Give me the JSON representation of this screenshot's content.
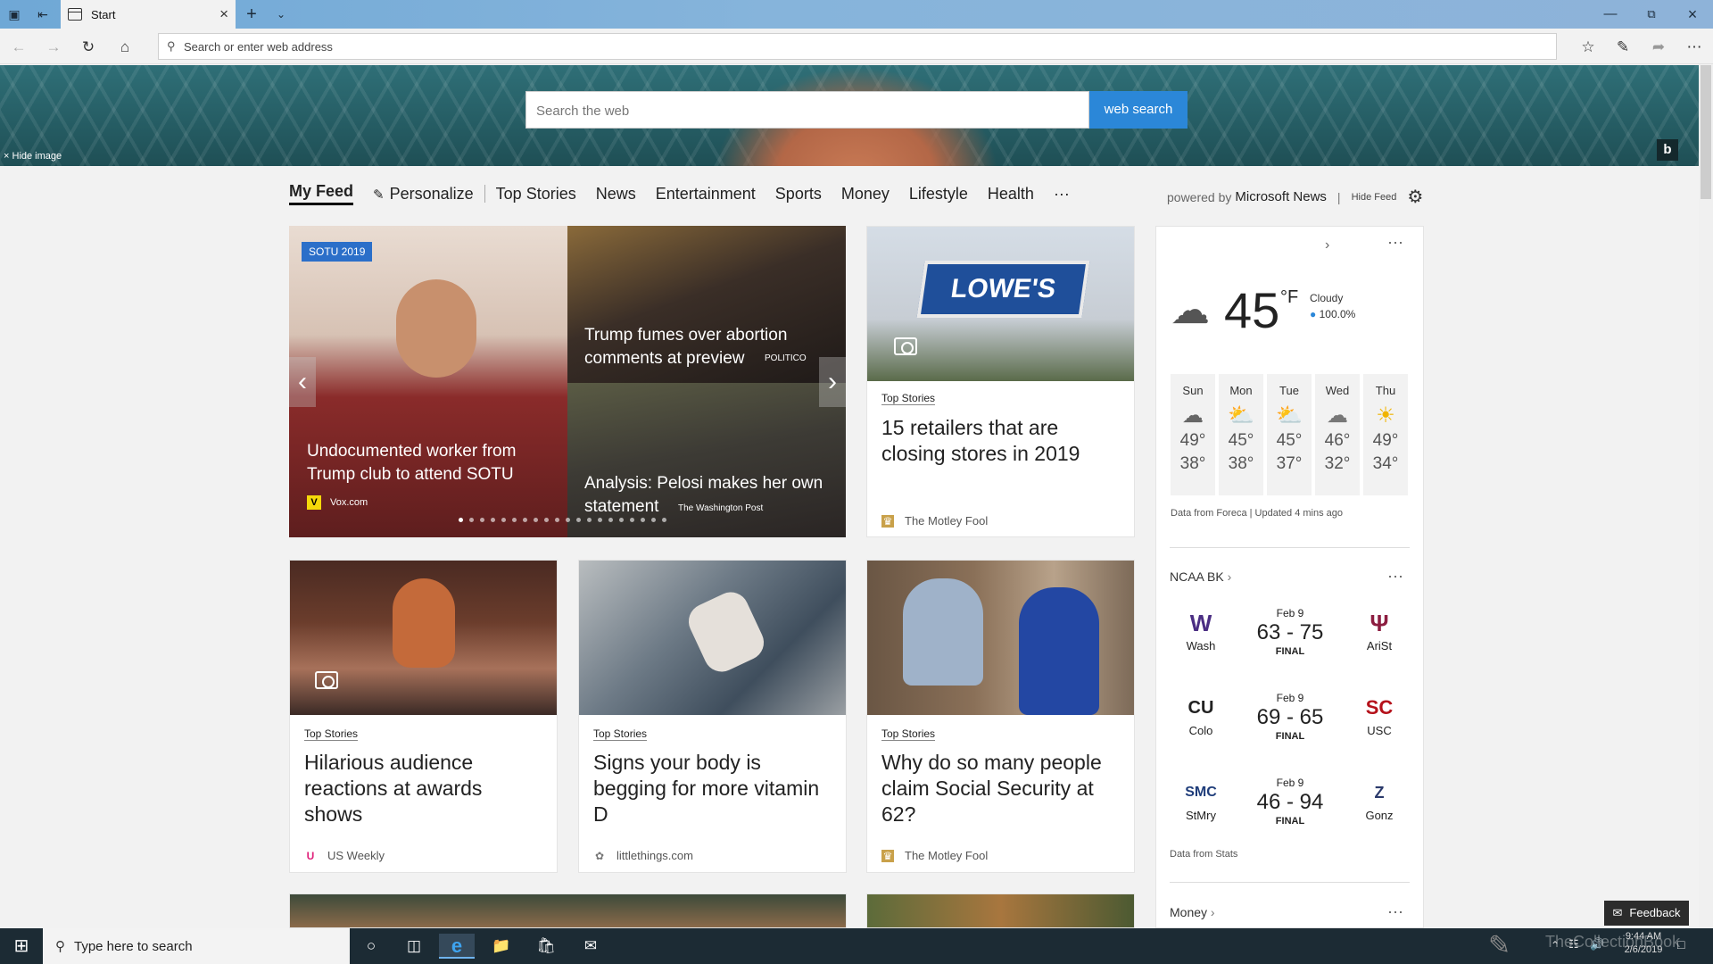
{
  "browser": {
    "tab_title": "Start",
    "address_placeholder": "Search or enter web address"
  },
  "hero": {
    "search_placeholder": "Search the web",
    "search_button": "web search",
    "hide_image": "Hide image",
    "bing_logo": "b"
  },
  "feed_nav": {
    "items": [
      "My Feed",
      "Personalize",
      "Top Stories",
      "News",
      "Entertainment",
      "Sports",
      "Money",
      "Lifestyle",
      "Health",
      "···"
    ],
    "powered_by": "powered by",
    "provider": "Microsoft News",
    "hide_feed": "Hide Feed"
  },
  "carousel": {
    "badge": "SOTU 2019",
    "main_title": "Undocumented worker from Trump club to attend SOTU",
    "main_source": "Vox.com",
    "top_right_title": "Trump fumes over abortion comments at preview",
    "top_right_source": "POLITICO",
    "bottom_right_title": "Analysis: Pelosi makes her own statement",
    "bottom_right_source": "The Washington Post",
    "dot_count": 20,
    "active_dot": 0
  },
  "cards": [
    {
      "category": "Top Stories",
      "title": "15 retailers that are closing stores in 2019",
      "source": "The Motley Fool",
      "image_text": "LOWE'S"
    },
    {
      "category": "Top Stories",
      "title": "Hilarious audience reactions at awards shows",
      "source": "US Weekly"
    },
    {
      "category": "Top Stories",
      "title": "Signs your body is begging for more vitamin D",
      "source": "littlethings.com"
    },
    {
      "category": "Top Stories",
      "title": "Why do so many people claim Social Security at 62?",
      "source": "The Motley Fool"
    }
  ],
  "weather": {
    "temp": "45",
    "unit": "°F",
    "condition": "Cloudy",
    "precip": "100.0%",
    "days": [
      {
        "day": "Sun",
        "hi": "49°",
        "lo": "38°",
        "icon": "rain-cloud-icon"
      },
      {
        "day": "Mon",
        "hi": "45°",
        "lo": "38°",
        "icon": "partly-sunny-icon"
      },
      {
        "day": "Tue",
        "hi": "45°",
        "lo": "37°",
        "icon": "partly-sunny-icon"
      },
      {
        "day": "Wed",
        "hi": "46°",
        "lo": "32°",
        "icon": "cloud-icon"
      },
      {
        "day": "Thu",
        "hi": "49°",
        "lo": "34°",
        "icon": "sun-icon"
      }
    ],
    "footer": "Data from Foreca | Updated 4 mins ago"
  },
  "sports": {
    "title": "NCAA BK",
    "games": [
      {
        "date": "Feb 9",
        "score": "63 - 75",
        "status": "FINAL",
        "home": "Wash",
        "away": "AriSt",
        "home_logo": "W",
        "away_logo": "Ψ"
      },
      {
        "date": "Feb 9",
        "score": "69 - 65",
        "status": "FINAL",
        "home": "Colo",
        "away": "USC",
        "home_logo": "CU",
        "away_logo": "SC"
      },
      {
        "date": "Feb 9",
        "score": "46 - 94",
        "status": "FINAL",
        "home": "StMry",
        "away": "Gonz",
        "home_logo": "SMC",
        "away_logo": "Z"
      }
    ],
    "footer": "Data from Stats"
  },
  "money_title": "Money",
  "feedback": "Feedback",
  "taskbar": {
    "search_placeholder": "Type here to search",
    "time": "9:44 AM",
    "date": "2/6/2019",
    "watermark": "TheCollectionBook"
  }
}
